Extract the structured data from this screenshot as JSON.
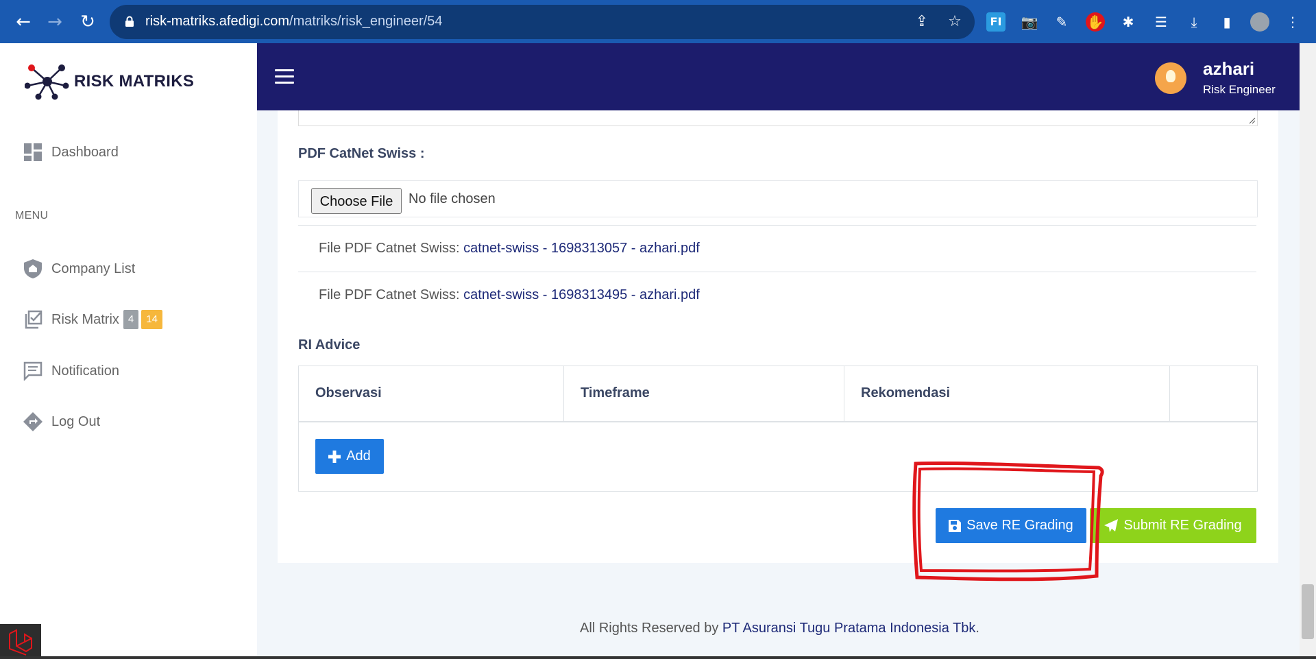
{
  "browser": {
    "url_host": "risk-matriks.afedigi.com",
    "url_path": "/matriks/risk_engineer/54"
  },
  "sidebar": {
    "brand": "RISK MATRIKS",
    "dashboard": "Dashboard",
    "menu_label": "MENU",
    "items": [
      {
        "label": "Company List"
      },
      {
        "label": "Risk Matrix",
        "badges": [
          "4",
          "14"
        ]
      },
      {
        "label": "Notification"
      },
      {
        "label": "Log Out"
      }
    ]
  },
  "header": {
    "username": "azhari",
    "role": "Risk Engineer"
  },
  "form": {
    "catnet_label": "PDF CatNet Swiss :",
    "choose_file": "Choose File",
    "no_file": "No file chosen",
    "files": [
      {
        "prefix": "File PDF Catnet Swiss: ",
        "name": "catnet-swiss - 1698313057 - azhari.pdf"
      },
      {
        "prefix": "File PDF Catnet Swiss: ",
        "name": "catnet-swiss - 1698313495 - azhari.pdf"
      }
    ],
    "ri_advice_label": "RI Advice",
    "table_headers": [
      "Observasi",
      "Timeframe",
      "Rekomendasi",
      ""
    ],
    "add_label": "Add",
    "save_label": "Save RE Grading",
    "submit_label": "Submit RE Grading"
  },
  "footer": {
    "prefix": "All Rights Reserved by ",
    "company": "PT Asuransi Tugu Pratama Indonesia Tbk",
    "suffix": "."
  },
  "colors": {
    "header_bg": "#1c1c6c",
    "primary": "#1f7ae0",
    "success": "#8ed31b",
    "highlight": "#e0161b"
  }
}
